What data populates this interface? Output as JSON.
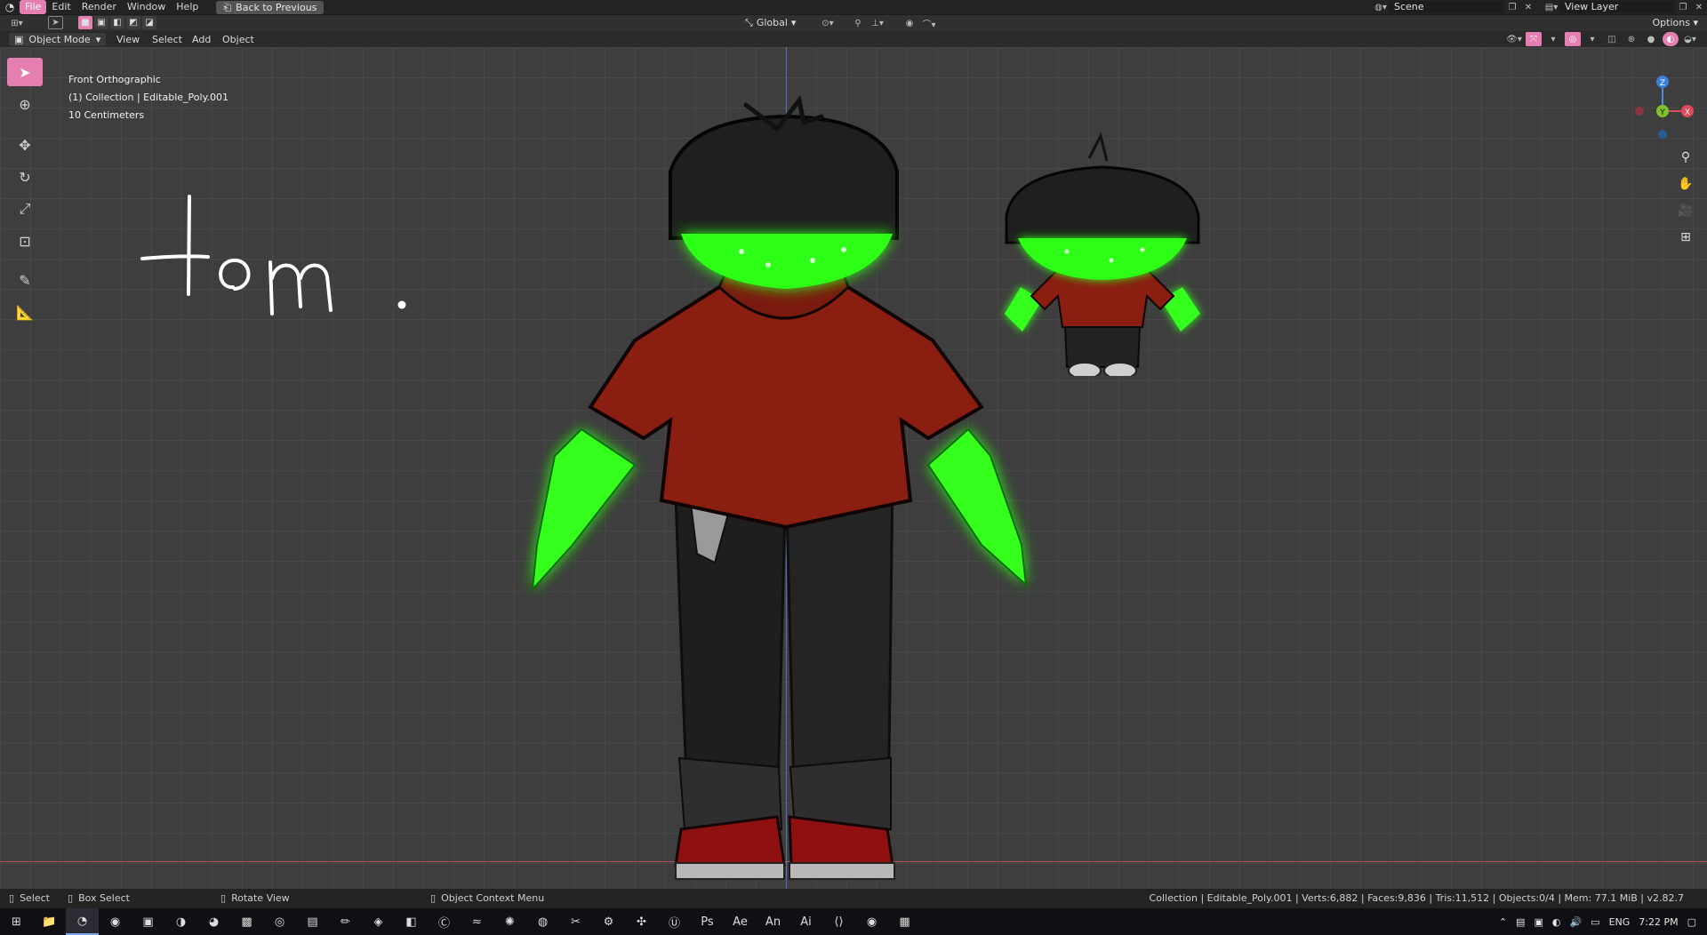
{
  "topbar": {
    "menus": [
      "File",
      "Edit",
      "Render",
      "Window",
      "Help"
    ],
    "back_button": "Back to Previous",
    "scene": "Scene",
    "view_layer": "View Layer"
  },
  "header": {
    "mode": "Object Mode",
    "menus": [
      "View",
      "Select",
      "Add",
      "Object"
    ],
    "orientation": "Global",
    "options": "Options"
  },
  "viewport": {
    "view_name": "Front Orthographic",
    "collection": "(1) Collection | Editable_Poly.001",
    "scale": "10 Centimeters",
    "annotation": "tom."
  },
  "gizmo": {
    "z": "Z",
    "y": "Y",
    "x": "X"
  },
  "statusbar": {
    "select": "Select",
    "box_select": "Box Select",
    "rotate_view": "Rotate View",
    "context_menu": "Object Context Menu",
    "stats": "Collection | Editable_Poly.001 | Verts:6,882 | Faces:9,836 | Tris:11,512 | Objects:0/4 | Mem: 77.1 MiB | v2.82.7"
  },
  "taskbar": {
    "language": "ENG",
    "time": "7:22 PM"
  },
  "colors": {
    "accent": "#e57fb2",
    "glow_green": "#33ff1a",
    "shirt_red": "#8c1d10"
  }
}
